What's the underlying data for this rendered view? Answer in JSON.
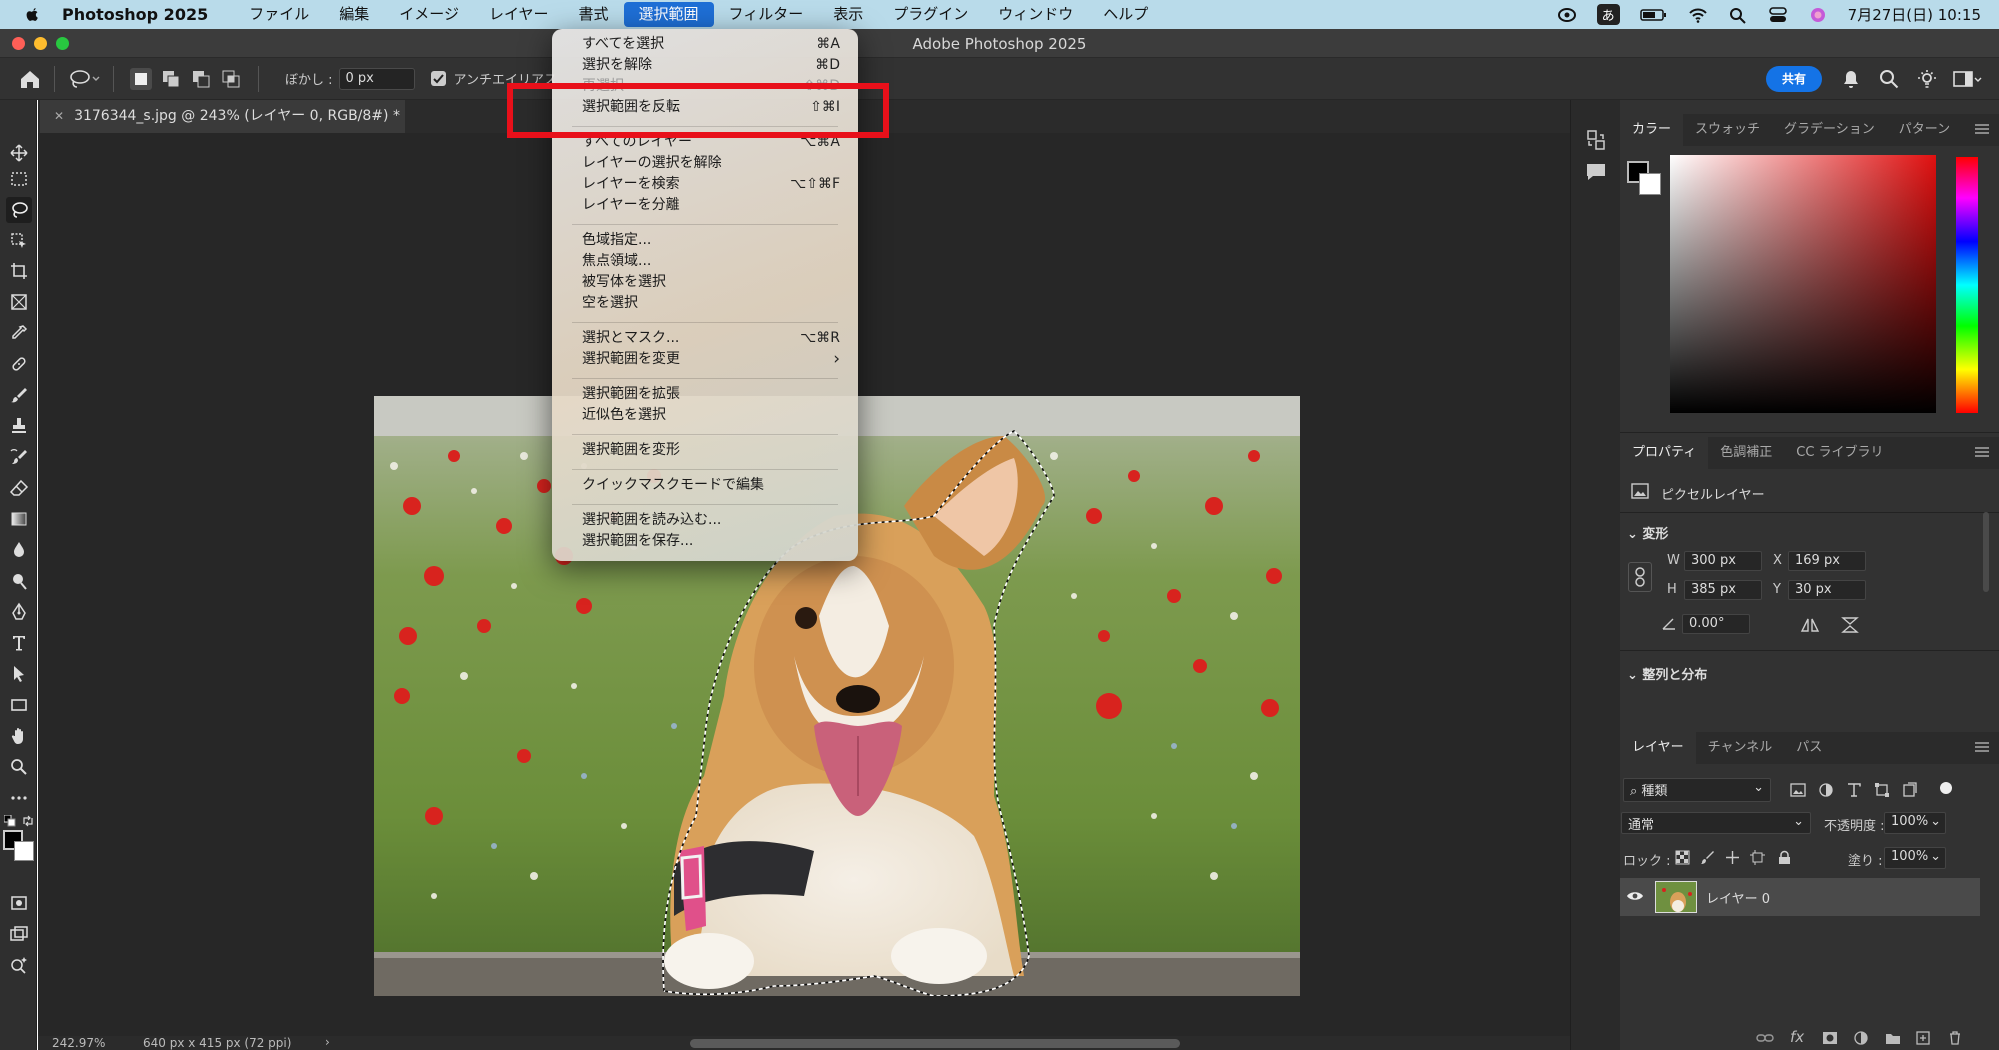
{
  "menubar": {
    "app_name": "Photoshop 2025",
    "items": [
      "ファイル",
      "編集",
      "イメージ",
      "レイヤー",
      "書式",
      "選択範囲",
      "フィルター",
      "表示",
      "プラグイン",
      "ウィンドウ",
      "ヘルプ"
    ],
    "active_index": 5,
    "ime": "あ",
    "datetime": "7月27日(日)  10:15"
  },
  "window": {
    "title": "Adobe Photoshop 2025"
  },
  "options": {
    "feather_label": "ぼかし :",
    "feather_value": "0 px",
    "antialias_label": "アンチエイリアス",
    "share_label": "共有"
  },
  "document": {
    "tab_title": "3176344_s.jpg @ 243% (レイヤー 0, RGB/8#) *",
    "zoom": "242.97%",
    "info": "640 px x 415 px (72 ppi)"
  },
  "select_menu": {
    "items": [
      {
        "label": "すべてを選択",
        "shortcut": "⌘A"
      },
      {
        "label": "選択を解除",
        "shortcut": "⌘D"
      },
      {
        "label": "再選択",
        "shortcut": "⇧⌘D"
      },
      {
        "label": "選択範囲を反転",
        "shortcut": "⇧⌘I"
      },
      {
        "label": "すべてのレイヤー",
        "shortcut": "⌥⌘A"
      },
      {
        "label": "レイヤーの選択を解除",
        "shortcut": ""
      },
      {
        "label": "レイヤーを検索",
        "shortcut": "⌥⇧⌘F"
      },
      {
        "label": "レイヤーを分離",
        "shortcut": ""
      },
      {
        "label": "色域指定...",
        "shortcut": ""
      },
      {
        "label": "焦点領域...",
        "shortcut": ""
      },
      {
        "label": "被写体を選択",
        "shortcut": ""
      },
      {
        "label": "空を選択",
        "shortcut": ""
      },
      {
        "label": "選択とマスク...",
        "shortcut": "⌥⌘R"
      },
      {
        "label": "選択範囲を変更",
        "shortcut": "›"
      },
      {
        "label": "選択範囲を拡張",
        "shortcut": ""
      },
      {
        "label": "近似色を選択",
        "shortcut": ""
      },
      {
        "label": "選択範囲を変形",
        "shortcut": ""
      },
      {
        "label": "クイックマスクモードで編集",
        "shortcut": ""
      },
      {
        "label": "選択範囲を読み込む...",
        "shortcut": ""
      },
      {
        "label": "選択範囲を保存...",
        "shortcut": ""
      }
    ]
  },
  "color_panel": {
    "tabs": [
      "カラー",
      "スウォッチ",
      "グラデーション",
      "パターン"
    ]
  },
  "properties_panel": {
    "tabs": [
      "プロパティ",
      "色調補正",
      "CC ライブラリ"
    ],
    "layer_type": "ピクセルレイヤー",
    "transform_label": "変形",
    "w_label": "W",
    "w_value": "300 px",
    "h_label": "H",
    "h_value": "385 px",
    "x_label": "X",
    "x_value": "169 px",
    "y_label": "Y",
    "y_value": "30 px",
    "angle_value": "0.00°",
    "align_label": "整列と分布"
  },
  "layers_panel": {
    "tabs": [
      "レイヤー",
      "チャンネル",
      "パス"
    ],
    "filter_value": "種類",
    "blend_mode": "通常",
    "opacity_label": "不透明度 :",
    "opacity_value": "100%",
    "lock_label": "ロック :",
    "fill_label": "塗り :",
    "fill_value": "100%",
    "layer_name": "レイヤー 0"
  },
  "colors": {
    "accent": "#1473e6",
    "highlight": "#e8101a",
    "menubar": "#b9dbea"
  }
}
